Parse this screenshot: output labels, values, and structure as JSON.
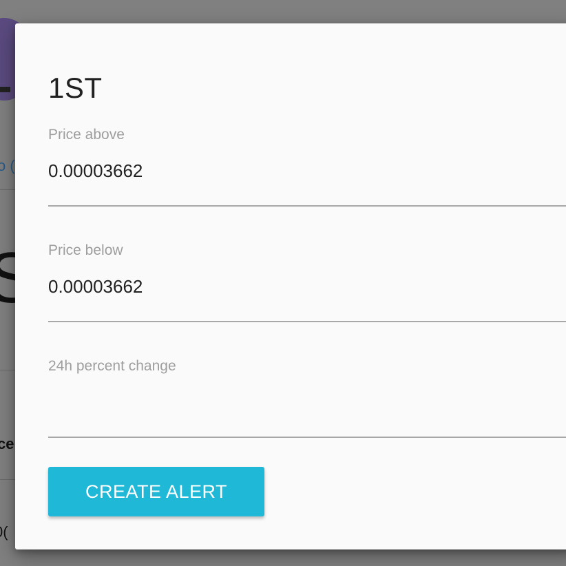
{
  "background": {
    "link_fragment": "o (",
    "big_glyph": "S",
    "text_fragment_a": "ce",
    "text_fragment_b": "0("
  },
  "modal": {
    "title": "1ST",
    "fields": {
      "price_above": {
        "label": "Price above",
        "value": "0.00003662"
      },
      "price_below": {
        "label": "Price below",
        "value": "0.00003662"
      },
      "percent_change": {
        "label": "24h percent change",
        "value": ""
      }
    },
    "create_button_label": "CREATE ALERT"
  },
  "colors": {
    "accent": "#1fb8d6",
    "overlay": "#808080",
    "modal_bg": "#fafafa",
    "label": "#9e9e9e"
  }
}
